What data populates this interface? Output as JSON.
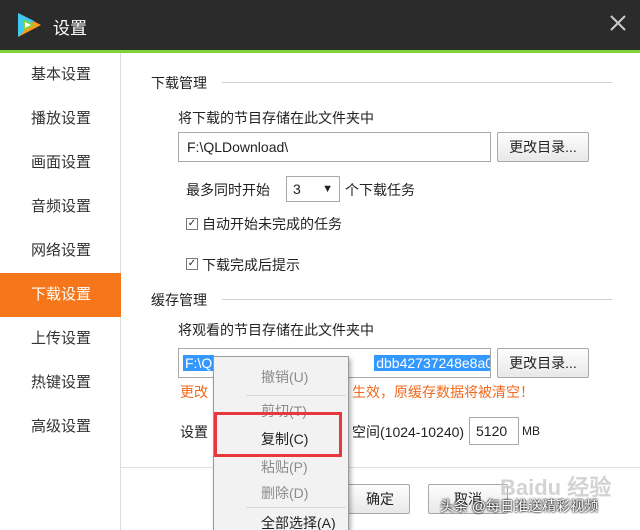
{
  "window": {
    "title": "设置",
    "close_glyph": "✕",
    "logo_icon": "tencent-video-logo"
  },
  "sidebar": {
    "items": [
      {
        "label": "基本设置",
        "active": false
      },
      {
        "label": "播放设置",
        "active": false
      },
      {
        "label": "画面设置",
        "active": false
      },
      {
        "label": "音频设置",
        "active": false
      },
      {
        "label": "网络设置",
        "active": false
      },
      {
        "label": "下载设置",
        "active": true
      },
      {
        "label": "上传设置",
        "active": false
      },
      {
        "label": "热键设置",
        "active": false
      },
      {
        "label": "高级设置",
        "active": false
      }
    ]
  },
  "download": {
    "section_title": "下载管理",
    "folder_caption": "将下载的节目存储在此文件夹中",
    "path_value": "F:\\QLDownload\\",
    "change_dir_label": "更改目录...",
    "max_tasks_prefix": "最多同时开始",
    "max_tasks_value": "3",
    "max_tasks_suffix": "个下载任务",
    "auto_start_label": "自动开始未完成的任务",
    "auto_start_checked": true,
    "notify_label": "下载完成后提示",
    "notify_checked": true
  },
  "cache": {
    "section_title": "缓存管理",
    "folder_caption": "将观看的节目存储在此文件夹中",
    "path_visible_start": "F:\\Q",
    "path_visible_end": "dbb42737248e8a0",
    "change_dir_label": "更改目录...",
    "warning_prefix": "更改",
    "warning_suffix": "生效，原缓存数据将被清空！",
    "size_label_prefix": "设置",
    "size_label_suffix": "空间(1024-10240)",
    "size_value": "5120",
    "size_unit": "MB"
  },
  "context_menu": {
    "items": [
      {
        "label": "撤销(U)",
        "enabled": false
      },
      {
        "label": "剪切(T)",
        "enabled": false
      },
      {
        "label": "复制(C)",
        "enabled": true
      },
      {
        "label": "粘贴(P)",
        "enabled": false
      },
      {
        "label": "删除(D)",
        "enabled": false
      },
      {
        "label": "全部选择(A)",
        "enabled": true
      }
    ]
  },
  "footer": {
    "ok_label": "确定",
    "cancel_label": "取消"
  },
  "watermark": {
    "text": "头条 @每日推送精彩视频",
    "baidu": "Baidu 经验"
  },
  "colors": {
    "accent": "#f6771b",
    "titlebar": "#2b2b2b",
    "green": "#7fd337",
    "warning": "#f06a1c",
    "highlight": "#e8383d"
  }
}
